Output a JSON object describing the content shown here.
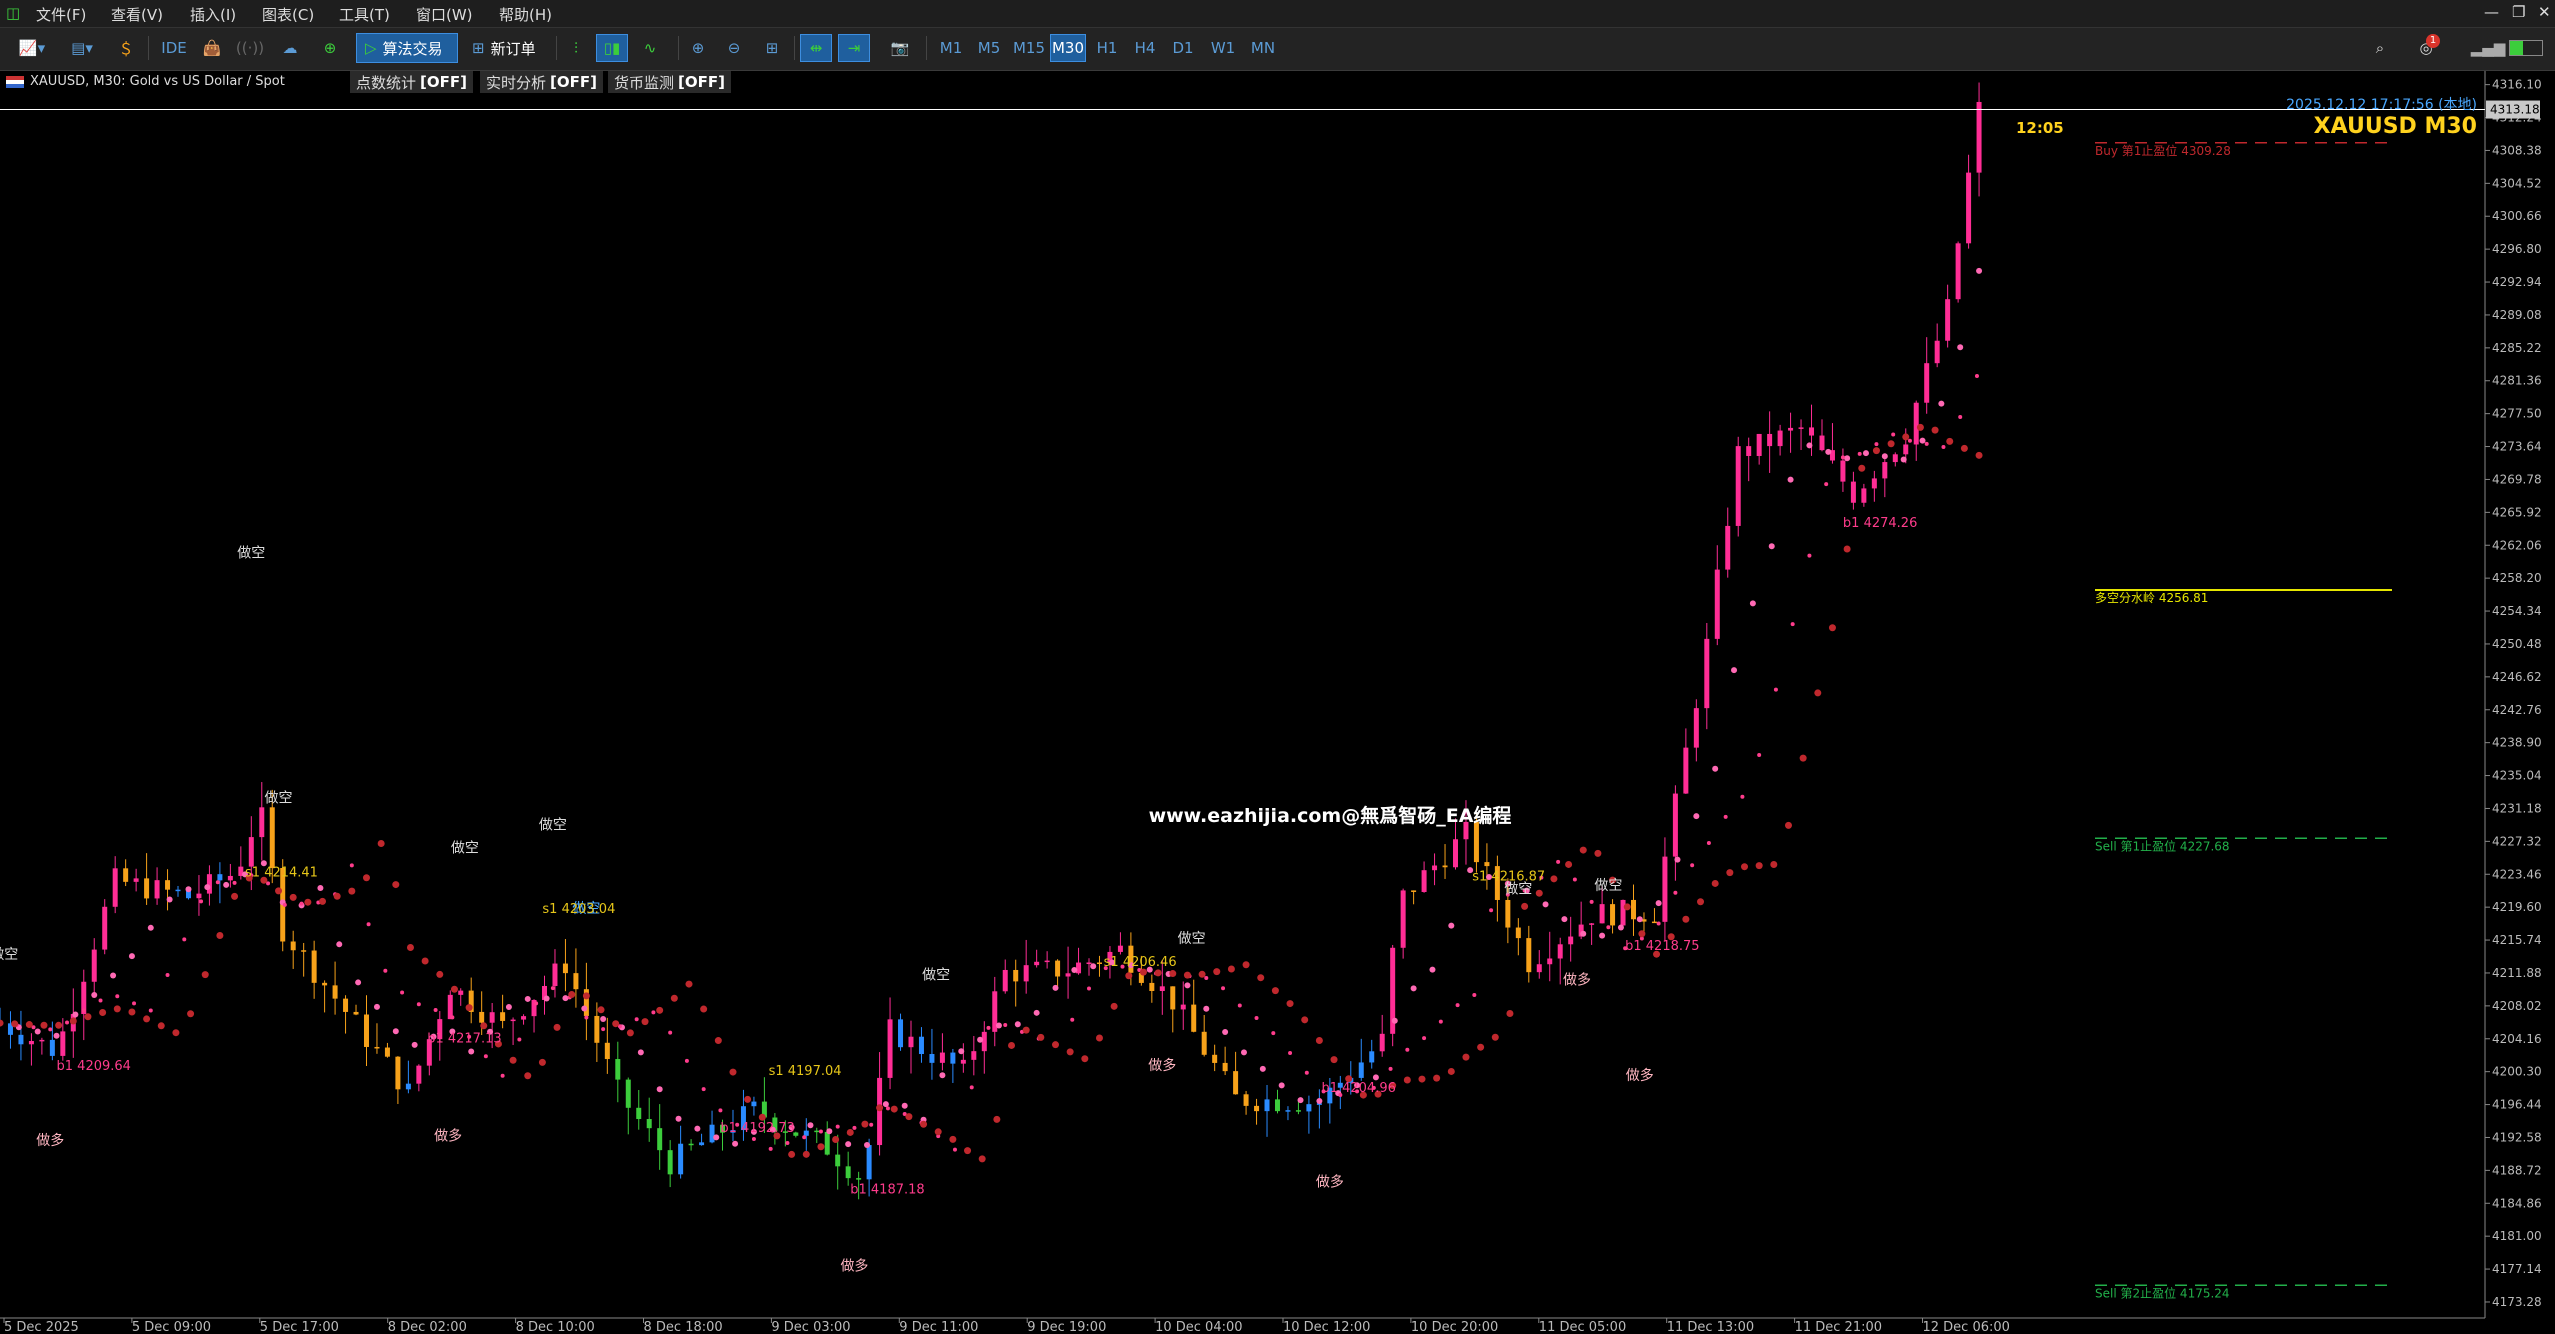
{
  "menu": {
    "items": [
      "文件(F)",
      "查看(V)",
      "插入(I)",
      "图表(C)",
      "工具(T)",
      "窗口(W)",
      "帮助(H)"
    ]
  },
  "toolbar": {
    "ide_label": "IDE",
    "algo_trading_label": "算法交易",
    "new_order_label": "新订单",
    "timeframes": [
      "M1",
      "M5",
      "M15",
      "M30",
      "H1",
      "H4",
      "D1",
      "W1",
      "MN"
    ],
    "active_timeframe": "M30",
    "notification_count": "1"
  },
  "chart_header": {
    "symbol_info": "XAUUSD, M30:  Gold vs US Dollar / Spot",
    "status_buttons": [
      {
        "label": "点数统计",
        "state": "[OFF]"
      },
      {
        "label": "实时分析",
        "state": "[OFF]"
      },
      {
        "label": "货币监测",
        "state": "[OFF]"
      }
    ],
    "datetime": "2025.12.12 17:17:56 (本地)",
    "symbol_title": "XAUUSD M30",
    "countdown": "12:05",
    "current_price": "4313.18",
    "watermark": "www.eazhijia.com@無爲智砀_EA编程"
  },
  "levels": [
    {
      "label": "Buy 第1止盈位 4309.28",
      "price": 4309.28,
      "color": "#c0282d",
      "dash": true
    },
    {
      "label": "多空分水岭 4256.81",
      "price": 4256.81,
      "color": "#e6e600",
      "dash": false
    },
    {
      "label": "Sell 第1止盈位 4227.68",
      "price": 4227.68,
      "color": "#22b04a",
      "dash": true
    },
    {
      "label": "Sell 第2止盈位 4175.24",
      "price": 4175.24,
      "color": "#22b04a",
      "dash": true
    }
  ],
  "price_axis": [
    "4316.10",
    "4312.24",
    "4308.38",
    "4304.52",
    "4300.66",
    "4296.80",
    "4292.94",
    "4289.08",
    "4285.22",
    "4281.36",
    "4277.50",
    "4273.64",
    "4269.78",
    "4265.92",
    "4262.06",
    "4258.20",
    "4254.34",
    "4250.48",
    "4246.62",
    "4242.76",
    "4238.90",
    "4235.04",
    "4231.18",
    "4227.32",
    "4223.46",
    "4219.60",
    "4215.74",
    "4211.88",
    "4208.02",
    "4204.16",
    "4200.30",
    "4196.44",
    "4192.58",
    "4188.72",
    "4184.86",
    "4181.00",
    "4177.14",
    "4173.28"
  ],
  "time_axis": [
    "5 Dec 2025",
    "5 Dec 09:00",
    "5 Dec 17:00",
    "8 Dec 02:00",
    "8 Dec 10:00",
    "8 Dec 18:00",
    "9 Dec 03:00",
    "9 Dec 11:00",
    "9 Dec 19:00",
    "10 Dec 04:00",
    "10 Dec 12:00",
    "10 Dec 20:00",
    "11 Dec 05:00",
    "11 Dec 13:00",
    "11 Dec 21:00",
    "12 Dec 06:00"
  ],
  "signals": [
    {
      "text": "做空",
      "i": 2,
      "p": 4213.5,
      "color": "#ddd"
    },
    {
      "text": "做多",
      "i": 24,
      "p": 4191.7,
      "color": "#ffb6c1"
    },
    {
      "text": "做空",
      "i": 120,
      "p": 4260.6,
      "color": "#ddd"
    },
    {
      "text": "做空",
      "i": 133,
      "p": 4231.9,
      "color": "#ddd"
    },
    {
      "text": "做空",
      "i": 222,
      "p": 4226.0,
      "color": "#ddd"
    },
    {
      "text": "做空",
      "i": 264,
      "p": 4228.7,
      "color": "#ddd"
    },
    {
      "text": "做空",
      "i": 280,
      "p": 4218.9,
      "color": "#4aa8ff"
    },
    {
      "text": "做多",
      "i": 214,
      "p": 4192.2,
      "color": "#ffb6c1"
    },
    {
      "text": "做多",
      "i": 408,
      "p": 4177.0,
      "color": "#ffb6c1"
    },
    {
      "text": "做空",
      "i": 447,
      "p": 4211.1,
      "color": "#ddd"
    },
    {
      "text": "做多",
      "i": 555,
      "p": 4200.5,
      "color": "#ffb6c1"
    },
    {
      "text": "做空",
      "i": 569,
      "p": 4215.4,
      "color": "#ddd"
    },
    {
      "text": "做多",
      "i": 635,
      "p": 4186.8,
      "color": "#ffb6c1"
    },
    {
      "text": "做空",
      "i": 725,
      "p": 4221.2,
      "color": "#ddd"
    },
    {
      "text": "做多",
      "i": 753,
      "p": 4210.5,
      "color": "#ffb6c1"
    },
    {
      "text": "做空",
      "i": 768,
      "p": 4221.6,
      "color": "#ddd"
    },
    {
      "text": "做多",
      "i": 783,
      "p": 4199.3,
      "color": "#ffb6c1"
    }
  ],
  "level_tags": [
    {
      "text": "b1 4209.64",
      "i": 27,
      "p": 4200.5,
      "color": "#ff3c8c"
    },
    {
      "text": "s1 4214.41",
      "i": 117,
      "p": 4223.2,
      "color": "#e6c619"
    },
    {
      "text": "b1 4217.13",
      "i": 204,
      "p": 4203.7,
      "color": "#ff3c8c"
    },
    {
      "text": "s1 4203.04",
      "i": 259,
      "p": 4218.9,
      "color": "#e6c619"
    },
    {
      "text": "s1 4197.04",
      "i": 367,
      "p": 4199.9,
      "color": "#e6c619"
    },
    {
      "text": "b1 4192.73",
      "i": 344,
      "p": 4193.2,
      "color": "#ff3c8c"
    },
    {
      "text": "b1 4187.18",
      "i": 406,
      "p": 4186.0,
      "color": "#ff3c8c"
    },
    {
      "text": "s1 4206.46",
      "i": 527,
      "p": 4212.7,
      "color": "#e6c619"
    },
    {
      "text": "b1 4204.96",
      "i": 631,
      "p": 4197.9,
      "color": "#ff3c8c"
    },
    {
      "text": "s1 4216.87",
      "i": 703,
      "p": 4222.7,
      "color": "#e6c619"
    },
    {
      "text": "b1 4218.75",
      "i": 776,
      "p": 4214.6,
      "color": "#ff3c8c"
    },
    {
      "text": "b1 4274.26",
      "i": 880,
      "p": 4264.2,
      "color": "#ff3c8c"
    }
  ],
  "colors": {
    "background": "#000000",
    "bull_candle": "#ff2d95",
    "bear_candle": "#3ccd3c",
    "blue_candle": "#2a8bff",
    "orange_candle": "#f7a21a",
    "price_line": "#ffffff"
  },
  "chart_data": {
    "type": "candlestick",
    "symbol": "XAUUSD",
    "timeframe": "M30",
    "y_range": [
      4171.4,
      4317.7
    ],
    "x_range_bars": [
      0,
      955
    ],
    "anchors": [
      {
        "i": 0,
        "p": 4206.0
      },
      {
        "i": 27,
        "p": 4202.7
      },
      {
        "i": 55,
        "p": 4222.7
      },
      {
        "i": 90,
        "p": 4220.8
      },
      {
        "i": 113,
        "p": 4223.8
      },
      {
        "i": 124,
        "p": 4231.2
      },
      {
        "i": 135,
        "p": 4217.0
      },
      {
        "i": 165,
        "p": 4207.4
      },
      {
        "i": 195,
        "p": 4197.9
      },
      {
        "i": 215,
        "p": 4210.4
      },
      {
        "i": 240,
        "p": 4205.6
      },
      {
        "i": 270,
        "p": 4213.0
      },
      {
        "i": 295,
        "p": 4197.9
      },
      {
        "i": 320,
        "p": 4189.6
      },
      {
        "i": 360,
        "p": 4195.8
      },
      {
        "i": 395,
        "p": 4191.4
      },
      {
        "i": 412,
        "p": 4187.7
      },
      {
        "i": 425,
        "p": 4205.1
      },
      {
        "i": 460,
        "p": 4200.3
      },
      {
        "i": 480,
        "p": 4211.9
      },
      {
        "i": 510,
        "p": 4212.3
      },
      {
        "i": 535,
        "p": 4214.6
      },
      {
        "i": 560,
        "p": 4208.6
      },
      {
        "i": 590,
        "p": 4197.1
      },
      {
        "i": 630,
        "p": 4196.7
      },
      {
        "i": 660,
        "p": 4203.9
      },
      {
        "i": 668,
        "p": 4220.3
      },
      {
        "i": 700,
        "p": 4228.2
      },
      {
        "i": 730,
        "p": 4213.2
      },
      {
        "i": 760,
        "p": 4218.8
      },
      {
        "i": 790,
        "p": 4219.1
      },
      {
        "i": 815,
        "p": 4250.3
      },
      {
        "i": 830,
        "p": 4272.8
      },
      {
        "i": 860,
        "p": 4275.7
      },
      {
        "i": 885,
        "p": 4268.1
      },
      {
        "i": 910,
        "p": 4275.1
      },
      {
        "i": 930,
        "p": 4289.7
      },
      {
        "i": 945,
        "p": 4313.2
      }
    ]
  }
}
